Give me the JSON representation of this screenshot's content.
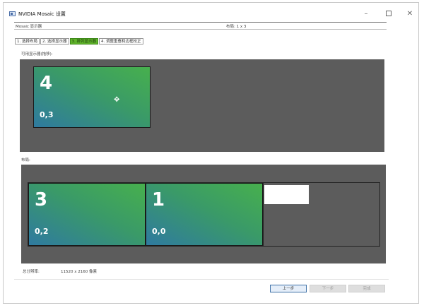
{
  "window": {
    "title": "NVIDIA Mosaic 设置"
  },
  "header": {
    "left_text": "Mosaic 显示器",
    "right_text": "布局: 1 x 3"
  },
  "steps": [
    {
      "label": "1. 选择布局"
    },
    {
      "label": "2. 选择显示器"
    },
    {
      "label": "3. 排列显示器"
    },
    {
      "label": "4. 调整重叠和边框校正"
    }
  ],
  "active_step_index": 2,
  "available_label": "可用显示器(拖移):",
  "available_display": {
    "number": "4",
    "position": "0,3"
  },
  "layout_label": "布局:",
  "layout_displays": [
    {
      "number": "3",
      "position": "0,2"
    },
    {
      "number": "1",
      "position": "0,0"
    }
  ],
  "resolution_label": "总分辨率:",
  "resolution_value": "11520 x 2160 像素",
  "buttons": {
    "prev": "上一步",
    "next": "下一步",
    "finish": "完成"
  },
  "icons": {
    "app": "nvidia-settings-icon",
    "minimize": "minimize-icon",
    "maximize": "maximize-icon",
    "close": "close-icon",
    "cursor": "move-cursor-icon"
  },
  "colors": {
    "panel_bg": "#5c5c5c",
    "active_step": "#5fb32a",
    "tile_gradient_start": "#2f7aa0",
    "tile_gradient_end": "#47b04d"
  }
}
